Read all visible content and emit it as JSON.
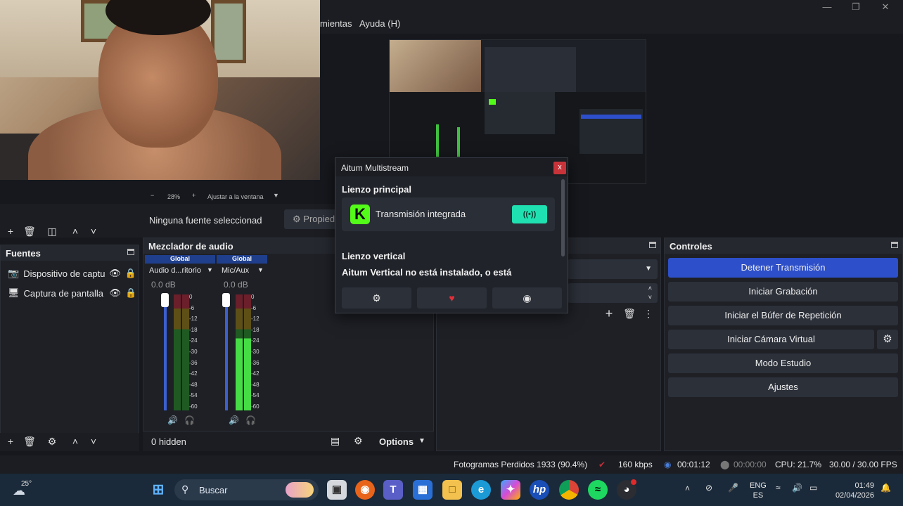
{
  "menu": {
    "items": [
      "mientas",
      "Ayuda (H)"
    ]
  },
  "preview_toolbar": {
    "zoom": "28%",
    "fit_label": "Ajustar a la ventana",
    "minus": "−",
    "plus": "+"
  },
  "properties_bar": {
    "no_source": "Ninguna fuente seleccionad",
    "properties_label": "Propied"
  },
  "sources": {
    "title": "Fuentes",
    "items": [
      {
        "label": "Dispositivo de captu",
        "icon": "camera-icon"
      },
      {
        "label": "Captura de pantalla",
        "icon": "monitor-icon"
      }
    ]
  },
  "mixer": {
    "title": "Mezclador de audio",
    "channels": [
      {
        "scope": "Global",
        "name": "Audio d...ritorio",
        "db": "0.0 dB"
      },
      {
        "scope": "Global",
        "name": "Mic/Aux",
        "db": "0.0 dB"
      }
    ],
    "ticks": [
      "0",
      "-6",
      "-12",
      "-18",
      "-24",
      "-30",
      "-36",
      "-42",
      "-48",
      "-54",
      "-60"
    ],
    "hidden_label": "0 hidden",
    "options_label": "Options"
  },
  "controls": {
    "title": "Controles",
    "buttons": [
      "Detener Transmisión",
      "Iniciar Grabación",
      "Iniciar el Búfer de Repetición",
      "Iniciar Cámara Virtual",
      "Modo Estudio",
      "Ajustes"
    ],
    "accent": "#2d4fc9"
  },
  "dialog": {
    "title": "Aitum Multistream",
    "close": "x",
    "main_canvas": "Lienzo principal",
    "service_name": "Transmisión integrada",
    "service_logo": "K",
    "vertical_canvas": "Lienzo vertical",
    "vertical_msg": "Aitum Vertical no está instalado, o está",
    "live_color": "#1fe0b0",
    "kick_color": "#53fc18"
  },
  "status": {
    "dropped": "Fotogramas Perdidos 1933 (90.4%)",
    "bitrate": "160 kbps",
    "stream_time": "00:01:12",
    "rec_time": "00:00:00",
    "cpu": "CPU: 21.7%",
    "fps": "30.00 / 30.00 FPS"
  },
  "taskbar": {
    "weather_temp": "25°",
    "search_placeholder": "Buscar",
    "lang_top": "ENG",
    "lang_bottom": "ES",
    "time": "01:49",
    "date": "02/04/2026"
  }
}
